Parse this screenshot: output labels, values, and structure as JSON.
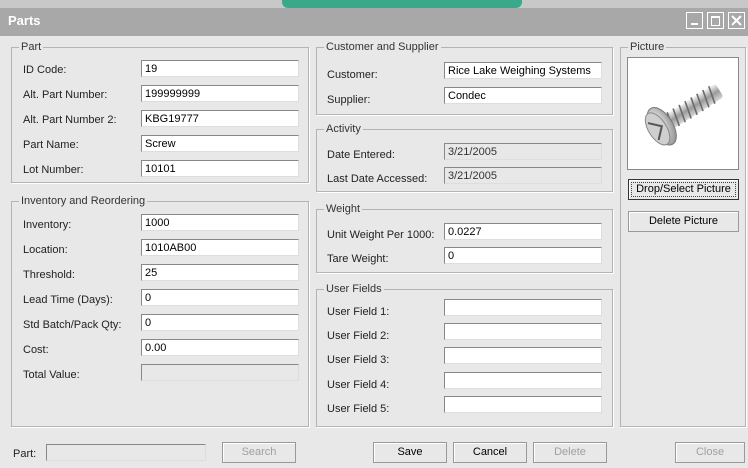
{
  "window": {
    "title": "Parts"
  },
  "part": {
    "legend": "Part",
    "id_code_label": "ID Code:",
    "id_code": "19",
    "alt_part_label": "Alt. Part Number:",
    "alt_part": "199999999",
    "alt_part2_label": "Alt. Part Number 2:",
    "alt_part2": "KBG19777",
    "name_label": "Part Name:",
    "name": "Screw",
    "lot_label": "Lot Number:",
    "lot": "10101"
  },
  "inventory": {
    "legend": "Inventory and Reordering",
    "inventory_label": "Inventory:",
    "inventory": "1000",
    "location_label": "Location:",
    "location": "1010AB00",
    "threshold_label": "Threshold:",
    "threshold": "25",
    "lead_time_label": "Lead Time (Days):",
    "lead_time": "0",
    "batch_label": "Std Batch/Pack Qty:",
    "batch": "0",
    "cost_label": "Cost:",
    "cost": "0.00",
    "total_label": "Total Value:",
    "total": ""
  },
  "customer_supplier": {
    "legend": "Customer and Supplier",
    "customer_label": "Customer:",
    "customer": "Rice Lake Weighing Systems",
    "supplier_label": "Supplier:",
    "supplier": "Condec"
  },
  "activity": {
    "legend": "Activity",
    "entered_label": "Date Entered:",
    "entered": "3/21/2005",
    "accessed_label": "Last Date Accessed:",
    "accessed": "3/21/2005"
  },
  "weight": {
    "legend": "Weight",
    "unit_label": "Unit Weight Per 1000:",
    "unit": "0.0227",
    "tare_label": "Tare Weight:",
    "tare": "0"
  },
  "user_fields": {
    "legend": "User Fields",
    "f1_label": "User Field 1:",
    "f1": "",
    "f2_label": "User Field 2:",
    "f2": "",
    "f3_label": "User Field 3:",
    "f3": "",
    "f4_label": "User Field 4:",
    "f4": "",
    "f5_label": "User Field 5:",
    "f5": ""
  },
  "picture": {
    "legend": "Picture",
    "image_icon": "screw-icon",
    "drop_select_label": "Drop/Select Picture",
    "delete_label": "Delete Picture"
  },
  "footer": {
    "part_label": "Part:",
    "part_value": "",
    "search_label": "Search",
    "save_label": "Save",
    "cancel_label": "Cancel",
    "delete_label": "Delete",
    "close_label": "Close"
  }
}
